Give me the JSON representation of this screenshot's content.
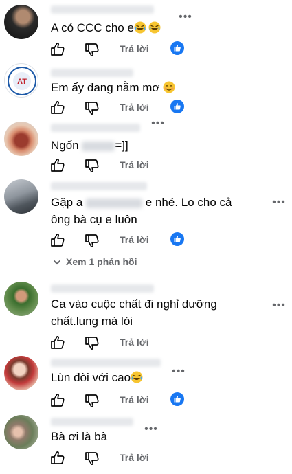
{
  "comments": [
    {
      "text": "A có CCC cho e",
      "emoji_count": 2,
      "has_like": true
    },
    {
      "text": "Em ấy đang nằm mơ",
      "emoji_count": 1,
      "has_like": true
    },
    {
      "text_before": "Ngốn",
      "text_after": "=]]",
      "has_like": false
    },
    {
      "line1_before": "Gặp a",
      "line1_after": "e nhé. Lo cho cả",
      "line2": "ông bà cụ e luôn",
      "has_like": true
    },
    {
      "line1": "Ca vào cuộc chất đi nghỉ dưỡng",
      "line2": "chất.lung mà lói",
      "has_like": false
    },
    {
      "text": "Lùn đòi với cao",
      "emoji_count": 1,
      "has_like": true
    },
    {
      "text": "Bà ơi là bà",
      "has_like": false
    }
  ],
  "labels": {
    "reply": "Trả lời",
    "view_replies": "Xem 1 phản hồi",
    "more": "•••"
  },
  "icons": {
    "like": "thumbs-up-outline-icon",
    "dislike": "thumbs-down-outline-icon",
    "reaction": "like-reaction-badge-icon",
    "emoji_laugh": "laughing-tears-emoji",
    "emoji_smile": "smiling-blush-emoji",
    "expand": "chevron-down-icon"
  },
  "colors": {
    "accent": "#1877f2",
    "muted_text": "#65676b",
    "text": "#050505"
  }
}
